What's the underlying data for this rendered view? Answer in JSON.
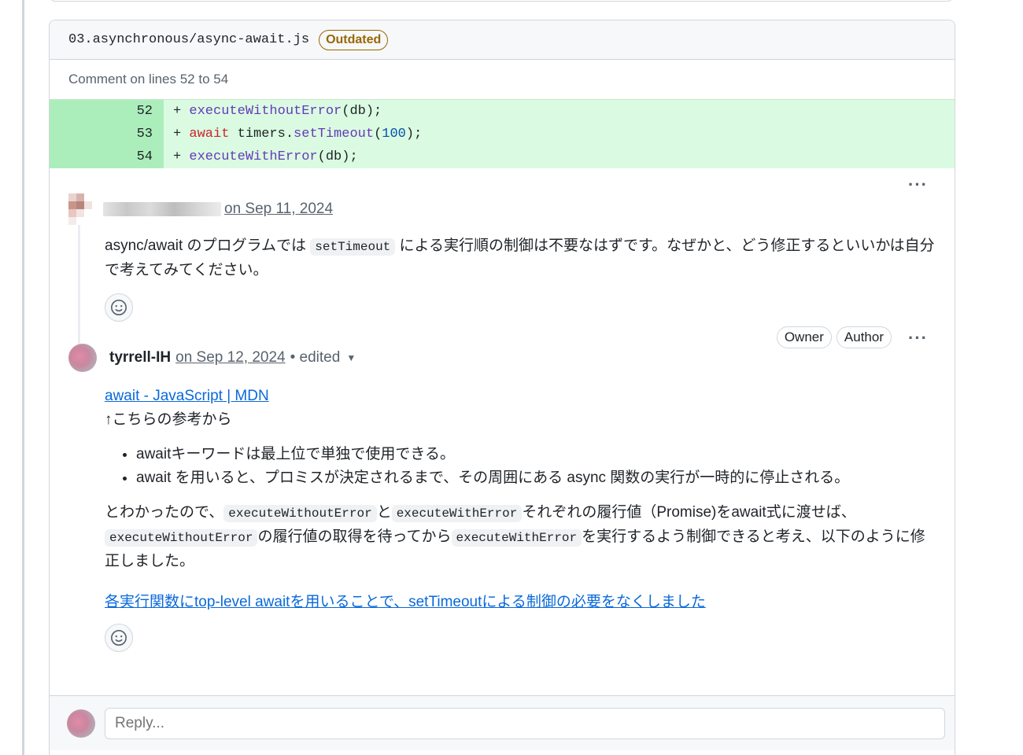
{
  "file": {
    "path": "03.asynchronous/async-await.js",
    "badge": "Outdated",
    "comment_on": "Comment on lines 52 to 54"
  },
  "diff": [
    {
      "num": "52",
      "prefix": "+ ",
      "parts": [
        [
          "fn",
          "executeWithoutError"
        ],
        [
          "plain",
          "(db);"
        ]
      ]
    },
    {
      "num": "53",
      "prefix": "+ ",
      "parts": [
        [
          "kw",
          "await"
        ],
        [
          "plain",
          " timers."
        ],
        [
          "fn",
          "setTimeout"
        ],
        [
          "plain",
          "("
        ],
        [
          "num",
          "100"
        ],
        [
          "plain",
          ");"
        ]
      ]
    },
    {
      "num": "54",
      "prefix": "+ ",
      "parts": [
        [
          "fn",
          "executeWithError"
        ],
        [
          "plain",
          "(db);"
        ]
      ]
    }
  ],
  "comment1": {
    "date": "on Sep 11, 2024",
    "more": "···",
    "text_before": "async/await のプログラムでは ",
    "code": "setTimeout",
    "text_after": " による実行順の制御は不要なはずです。なぜかと、どう修正するといいかは自分で考えてみてください。"
  },
  "comment2": {
    "author": "tyrrell-IH",
    "date": "on Sep 12, 2024",
    "edited": "• edited",
    "badges": [
      "Owner",
      "Author"
    ],
    "more": "···",
    "ref_link": "await - JavaScript | MDN",
    "ref_note": "↑こちらの参考から",
    "bullets": [
      "awaitキーワードは最上位で単独で使用できる。",
      "await を用いると、プロミスが決定されるまで、その周囲にある async 関数の実行が一時的に停止される。"
    ],
    "para": {
      "p1": "とわかったので、",
      "c1": "executeWithoutError",
      "p2": "と",
      "c2": "executeWithError",
      "p3": "それぞれの履行値（Promise)をawait式に渡せば、",
      "c3": "executeWithoutError",
      "p4": "の履行値の取得を待ってから",
      "c4": "executeWithError",
      "p5": "を実行するよう制御できると考え、以下のように修正しました。"
    },
    "commit_link": "各実行関数にtop-level awaitを用いることで、setTimeoutによる制御の必要をなくしました"
  },
  "reply": {
    "placeholder": "Reply..."
  },
  "colors": {
    "accent_link": "#0969da",
    "diff_add_bg": "#dafbe1",
    "outdated": "#9a6700"
  }
}
